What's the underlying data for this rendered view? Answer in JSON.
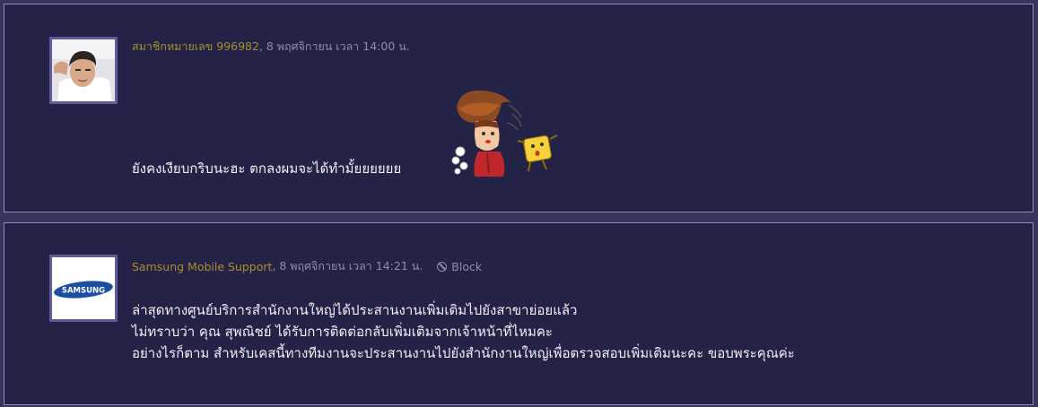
{
  "comments": [
    {
      "author": "สมาชิกหมายเลข 996982",
      "date": ", 8 พฤศจิกายน เวลา 14:00 น.",
      "lines": [
        "ยังคงเงียบกริบนะฮะ ตกลงผมจะได้ทำมั้ยยยยยย"
      ]
    },
    {
      "author": "Samsung Mobile Support",
      "date": ", 8 พฤศจิกายน เวลา 14:21 น.",
      "block_label": "Block",
      "logo_text": "SAMSUNG",
      "lines": [
        "ล่าสุดทางศูนย์บริการสำนักงานใหญ่ได้ประสานงานเพิ่มเติมไปยังสาขาย่อยแล้ว",
        "ไม่ทราบว่า คุณ สุพณิชย์ ได้รับการติดต่อกลับเพิ่มเติมจากเจ้าหน้าที่ไหมคะ",
        "อย่างไรก็ตาม สำหรับเคสนี้ทางทีมงานจะประสานงานไปยังสำนักงานใหญ่เพื่อตรวจสอบเพิ่มเติมนะคะ ขอบพระคุณค่ะ"
      ]
    }
  ],
  "colors": {
    "background": "#37355c",
    "card": "#242246",
    "author": "#a7902c",
    "meta": "#8f8da8",
    "text": "#f1f0f6",
    "samsung_blue": "#1d4fa0"
  }
}
